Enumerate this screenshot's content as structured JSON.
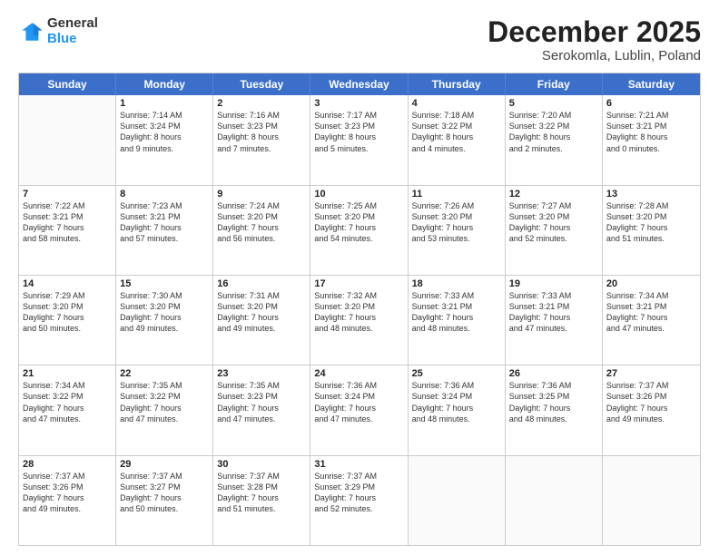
{
  "header": {
    "logo_line1": "General",
    "logo_line2": "Blue",
    "title": "December 2025",
    "subtitle": "Serokomla, Lublin, Poland"
  },
  "days_of_week": [
    "Sunday",
    "Monday",
    "Tuesday",
    "Wednesday",
    "Thursday",
    "Friday",
    "Saturday"
  ],
  "weeks": [
    [
      {
        "day": "",
        "empty": true
      },
      {
        "day": "1",
        "sunrise": "Sunrise: 7:14 AM",
        "sunset": "Sunset: 3:24 PM",
        "daylight": "Daylight: 8 hours and 9 minutes."
      },
      {
        "day": "2",
        "sunrise": "Sunrise: 7:16 AM",
        "sunset": "Sunset: 3:23 PM",
        "daylight": "Daylight: 8 hours and 7 minutes."
      },
      {
        "day": "3",
        "sunrise": "Sunrise: 7:17 AM",
        "sunset": "Sunset: 3:23 PM",
        "daylight": "Daylight: 8 hours and 5 minutes."
      },
      {
        "day": "4",
        "sunrise": "Sunrise: 7:18 AM",
        "sunset": "Sunset: 3:22 PM",
        "daylight": "Daylight: 8 hours and 4 minutes."
      },
      {
        "day": "5",
        "sunrise": "Sunrise: 7:20 AM",
        "sunset": "Sunset: 3:22 PM",
        "daylight": "Daylight: 8 hours and 2 minutes."
      },
      {
        "day": "6",
        "sunrise": "Sunrise: 7:21 AM",
        "sunset": "Sunset: 3:21 PM",
        "daylight": "Daylight: 8 hours and 0 minutes."
      }
    ],
    [
      {
        "day": "7",
        "sunrise": "Sunrise: 7:22 AM",
        "sunset": "Sunset: 3:21 PM",
        "daylight": "Daylight: 7 hours and 58 minutes."
      },
      {
        "day": "8",
        "sunrise": "Sunrise: 7:23 AM",
        "sunset": "Sunset: 3:21 PM",
        "daylight": "Daylight: 7 hours and 57 minutes."
      },
      {
        "day": "9",
        "sunrise": "Sunrise: 7:24 AM",
        "sunset": "Sunset: 3:20 PM",
        "daylight": "Daylight: 7 hours and 56 minutes."
      },
      {
        "day": "10",
        "sunrise": "Sunrise: 7:25 AM",
        "sunset": "Sunset: 3:20 PM",
        "daylight": "Daylight: 7 hours and 54 minutes."
      },
      {
        "day": "11",
        "sunrise": "Sunrise: 7:26 AM",
        "sunset": "Sunset: 3:20 PM",
        "daylight": "Daylight: 7 hours and 53 minutes."
      },
      {
        "day": "12",
        "sunrise": "Sunrise: 7:27 AM",
        "sunset": "Sunset: 3:20 PM",
        "daylight": "Daylight: 7 hours and 52 minutes."
      },
      {
        "day": "13",
        "sunrise": "Sunrise: 7:28 AM",
        "sunset": "Sunset: 3:20 PM",
        "daylight": "Daylight: 7 hours and 51 minutes."
      }
    ],
    [
      {
        "day": "14",
        "sunrise": "Sunrise: 7:29 AM",
        "sunset": "Sunset: 3:20 PM",
        "daylight": "Daylight: 7 hours and 50 minutes."
      },
      {
        "day": "15",
        "sunrise": "Sunrise: 7:30 AM",
        "sunset": "Sunset: 3:20 PM",
        "daylight": "Daylight: 7 hours and 49 minutes."
      },
      {
        "day": "16",
        "sunrise": "Sunrise: 7:31 AM",
        "sunset": "Sunset: 3:20 PM",
        "daylight": "Daylight: 7 hours and 49 minutes."
      },
      {
        "day": "17",
        "sunrise": "Sunrise: 7:32 AM",
        "sunset": "Sunset: 3:20 PM",
        "daylight": "Daylight: 7 hours and 48 minutes."
      },
      {
        "day": "18",
        "sunrise": "Sunrise: 7:33 AM",
        "sunset": "Sunset: 3:21 PM",
        "daylight": "Daylight: 7 hours and 48 minutes."
      },
      {
        "day": "19",
        "sunrise": "Sunrise: 7:33 AM",
        "sunset": "Sunset: 3:21 PM",
        "daylight": "Daylight: 7 hours and 47 minutes."
      },
      {
        "day": "20",
        "sunrise": "Sunrise: 7:34 AM",
        "sunset": "Sunset: 3:21 PM",
        "daylight": "Daylight: 7 hours and 47 minutes."
      }
    ],
    [
      {
        "day": "21",
        "sunrise": "Sunrise: 7:34 AM",
        "sunset": "Sunset: 3:22 PM",
        "daylight": "Daylight: 7 hours and 47 minutes."
      },
      {
        "day": "22",
        "sunrise": "Sunrise: 7:35 AM",
        "sunset": "Sunset: 3:22 PM",
        "daylight": "Daylight: 7 hours and 47 minutes."
      },
      {
        "day": "23",
        "sunrise": "Sunrise: 7:35 AM",
        "sunset": "Sunset: 3:23 PM",
        "daylight": "Daylight: 7 hours and 47 minutes."
      },
      {
        "day": "24",
        "sunrise": "Sunrise: 7:36 AM",
        "sunset": "Sunset: 3:24 PM",
        "daylight": "Daylight: 7 hours and 47 minutes."
      },
      {
        "day": "25",
        "sunrise": "Sunrise: 7:36 AM",
        "sunset": "Sunset: 3:24 PM",
        "daylight": "Daylight: 7 hours and 48 minutes."
      },
      {
        "day": "26",
        "sunrise": "Sunrise: 7:36 AM",
        "sunset": "Sunset: 3:25 PM",
        "daylight": "Daylight: 7 hours and 48 minutes."
      },
      {
        "day": "27",
        "sunrise": "Sunrise: 7:37 AM",
        "sunset": "Sunset: 3:26 PM",
        "daylight": "Daylight: 7 hours and 49 minutes."
      }
    ],
    [
      {
        "day": "28",
        "sunrise": "Sunrise: 7:37 AM",
        "sunset": "Sunset: 3:26 PM",
        "daylight": "Daylight: 7 hours and 49 minutes."
      },
      {
        "day": "29",
        "sunrise": "Sunrise: 7:37 AM",
        "sunset": "Sunset: 3:27 PM",
        "daylight": "Daylight: 7 hours and 50 minutes."
      },
      {
        "day": "30",
        "sunrise": "Sunrise: 7:37 AM",
        "sunset": "Sunset: 3:28 PM",
        "daylight": "Daylight: 7 hours and 51 minutes."
      },
      {
        "day": "31",
        "sunrise": "Sunrise: 7:37 AM",
        "sunset": "Sunset: 3:29 PM",
        "daylight": "Daylight: 7 hours and 52 minutes."
      },
      {
        "day": "",
        "empty": true
      },
      {
        "day": "",
        "empty": true
      },
      {
        "day": "",
        "empty": true
      }
    ]
  ]
}
